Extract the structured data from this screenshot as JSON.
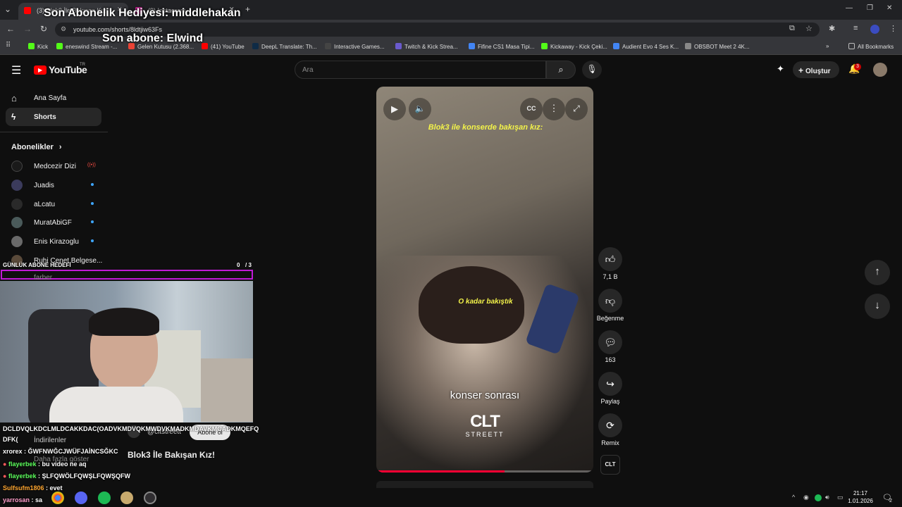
{
  "overlay": {
    "gift_text": "Son Abonelik Hediyesi: middlehakan",
    "sub_text": "Son abone: Elwind",
    "goal_label": "GÜNLÜK ABONE HEDEFİ",
    "goal_count": "0",
    "goal_total": "/ 3",
    "chat": [
      {
        "user": "",
        "text": "DCLDVQLKDCLMLDCAKKDAC(OADVKMDVQKMWDVKMADKMDAVKMCADKMQEFQ"
      },
      {
        "user": "",
        "text": "DFK("
      },
      {
        "user": "xrorex",
        "text": ": ĞWFNWĞCJWÜFJAİNCSĞKC"
      },
      {
        "user": "flayerbek",
        "text": ": bu video ne aq"
      },
      {
        "user": "flayerbek",
        "text": ": ŞLFQWÖLFQWŞLFQWŞQFW"
      },
      {
        "user": "Sulfsufm1806",
        "text": ": evet"
      },
      {
        "user": "yarrosan",
        "text": ": sa"
      }
    ]
  },
  "browser": {
    "tabs": [
      {
        "title": "(3) Blok3 İle Bakışan Kız!",
        "active": true
      },
      {
        "title": "(9) Instagram",
        "active": false
      }
    ],
    "url": "youtube.com/shorts/8ldtjiw63Fs",
    "bookmarks": [
      "Kick",
      "eneswind Stream -...",
      "Gelen Kutusu (2.368...",
      "(41) YouTube",
      "DeepL Translate: Th...",
      "Interactive Games...",
      "Twitch & Kick Strea...",
      "Fifine CS1 Masa Tipi...",
      "Kickaway - Kick Çeki...",
      "Audient Evo 4 Ses K...",
      "OBSBOT Meet 2 4K..."
    ],
    "all_bookmarks": "All Bookmarks"
  },
  "youtube": {
    "logo": "YouTube",
    "region": "TR",
    "search_placeholder": "Ara",
    "create_label": "Oluştur",
    "notif_count": "3",
    "sidebar": {
      "home": "Ana Sayfa",
      "shorts": "Shorts",
      "subs_header": "Abonelikler",
      "channels": [
        "Medcezir Dizi",
        "Juadis",
        "aLcatu",
        "MuratAbiGF",
        "Enis Kirazoglu",
        "Ruhi Çenet Belgese...",
        "farber"
      ],
      "downloads": "İndirilenler",
      "show_more": "Daha fazla göster"
    },
    "video": {
      "caption_top": "Blok3 ile konserde bakışan kız:",
      "caption_mid": "O kadar bakıştık",
      "caption_bottom": "konser sonrası",
      "brand": "CLT",
      "brand_sub": "STREETT",
      "channel": "@cltstreett",
      "subscribe": "Abone ol",
      "title": "Blok3 İle Bakışan Kız!",
      "progress": 0.59
    },
    "actions": {
      "likes": "7,1 B",
      "dislike": "Beğenme",
      "comments": "163",
      "share": "Paylaş",
      "remix": "Remix"
    }
  },
  "taskbar": {
    "time": "21:17",
    "date": "1.01.2026",
    "notif": "2"
  }
}
